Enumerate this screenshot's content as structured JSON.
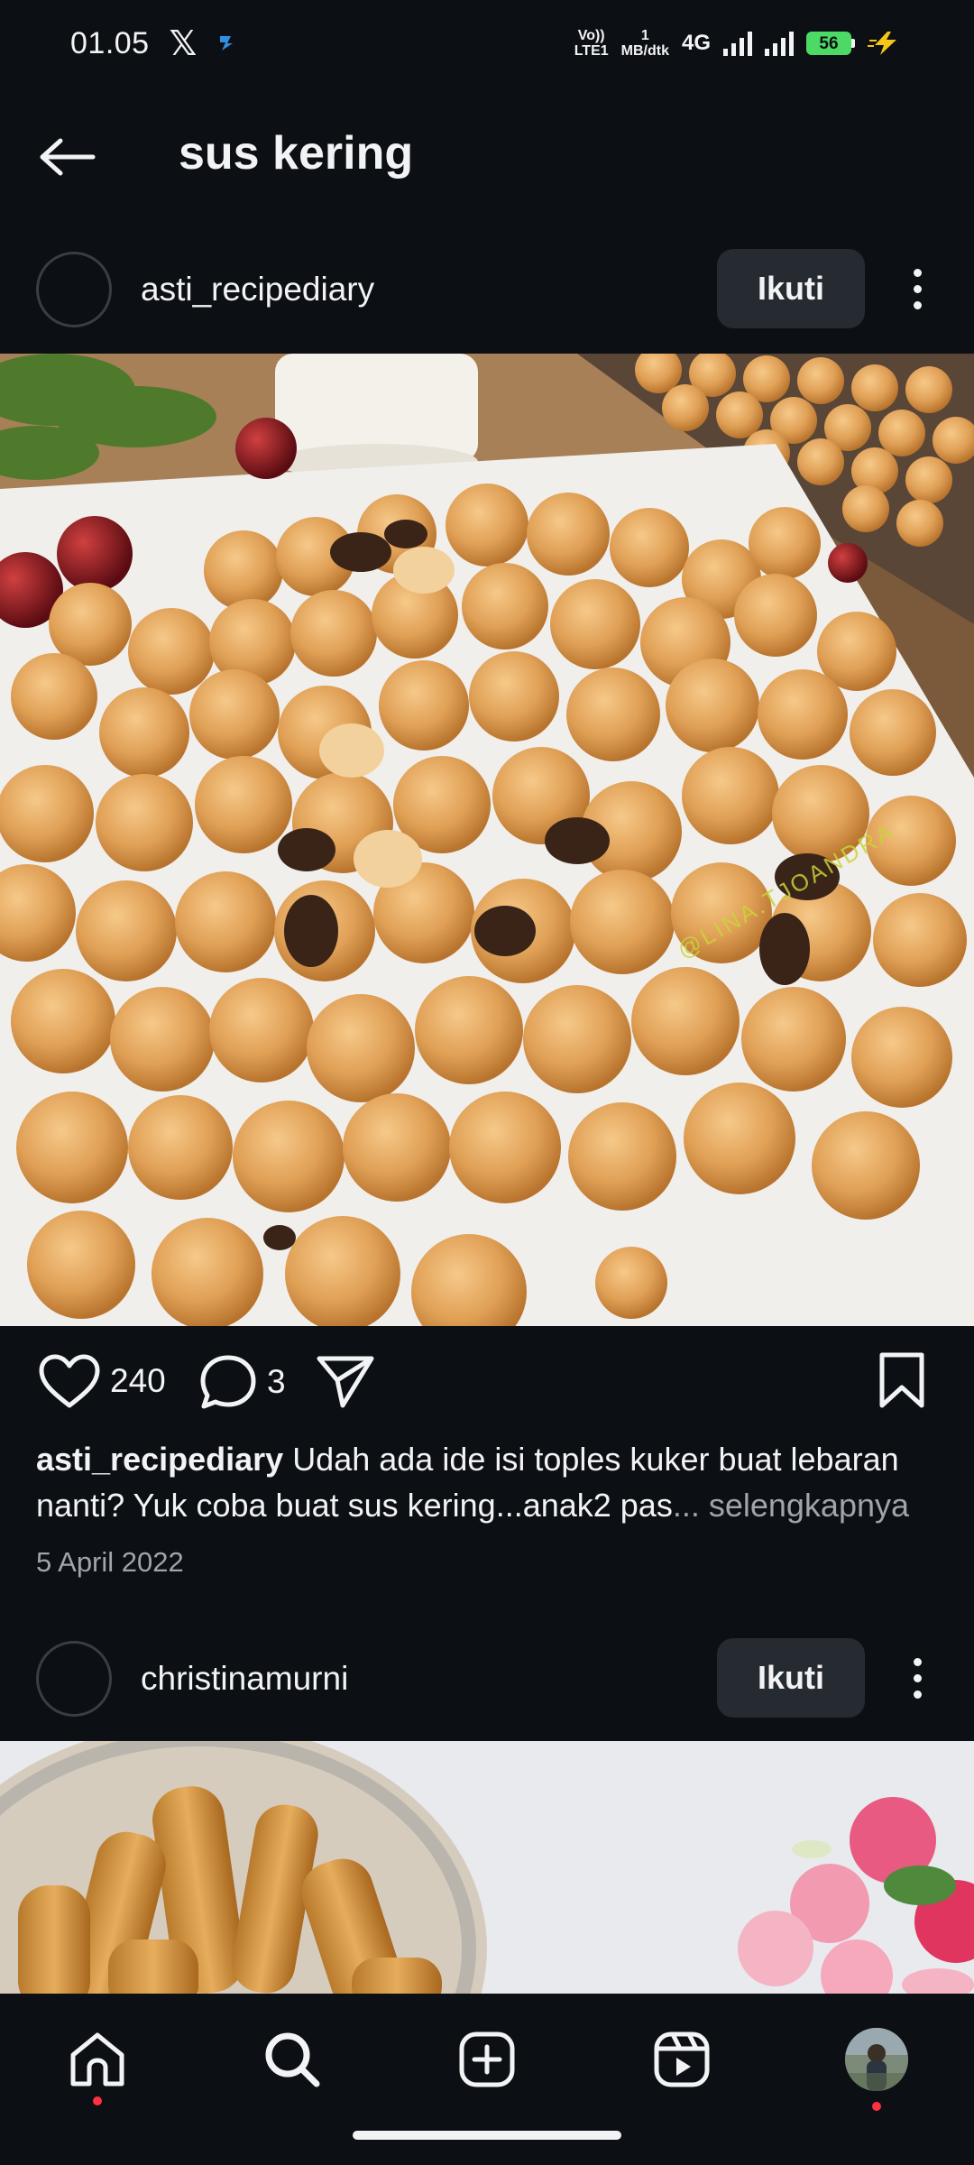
{
  "status_bar": {
    "time": "01.05",
    "volte": "Vo))",
    "lte": "LTE1",
    "speed_value": "1",
    "speed_unit": "MB/dtk",
    "network": "4G",
    "battery": "56"
  },
  "header": {
    "title": "sus kering"
  },
  "posts": [
    {
      "username": "asti_recipediary",
      "follow_label": "Ikuti",
      "image_watermark": "@LINA.TJOANDRA",
      "likes": "240",
      "comments": "3",
      "caption_user": "asti_recipediary",
      "caption_text": "Udah ada ide isi toples kuker buat lebaran nanti? Yuk coba buat sus kering...anak2 pas",
      "caption_more": "... selengkapnya",
      "date": "5 April 2022"
    },
    {
      "username": "christinamurni",
      "follow_label": "Ikuti"
    }
  ],
  "bottom_nav": {
    "items": [
      "home-icon",
      "search-icon",
      "create-icon",
      "reels-icon",
      "profile-avatar"
    ]
  },
  "colors": {
    "background": "#0c0f14",
    "button": "#262a31",
    "muted_text": "#a0a4ab",
    "battery": "#4cd964",
    "notification_dot": "#ff3040"
  }
}
